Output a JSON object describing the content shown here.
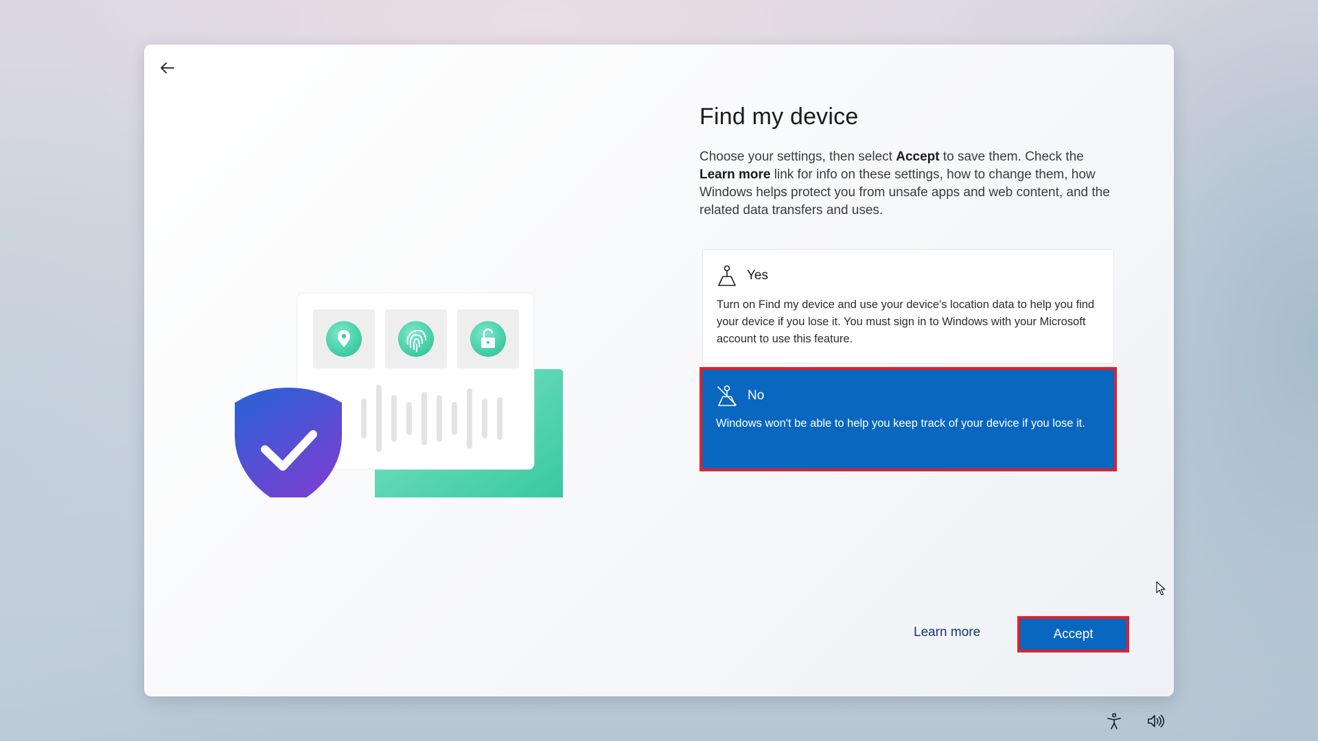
{
  "window": {
    "title": "Find my device",
    "description_parts": [
      "Choose your settings, then select ",
      "Accept",
      " to save them. Check the ",
      "Learn more",
      " link for info on these settings, how to change them, how Windows helps protect you from unsafe apps and web content, and the related data transfers and uses."
    ]
  },
  "options": {
    "yes": {
      "label": "Yes",
      "text": "Turn on Find my device and use your device's location data to help you find your device if you lose it. You must sign in to Windows with your Microsoft account to use this feature.",
      "icon": "location-person-icon"
    },
    "no": {
      "label": "No",
      "text": "Windows won't be able to help you keep track of your device if you lose it.",
      "icon": "location-off-icon",
      "selected": true
    }
  },
  "footer": {
    "learn_more": "Learn more",
    "accept": "Accept"
  },
  "tray": {
    "icons": [
      "accessibility-icon",
      "volume-icon"
    ]
  },
  "colors": {
    "accent": "#0a67c0",
    "highlight_border": "#e0202b",
    "illustration_teal": "#3ecfa6",
    "shield_blue": "#2f5fd8",
    "shield_purple": "#7a3fd1"
  }
}
